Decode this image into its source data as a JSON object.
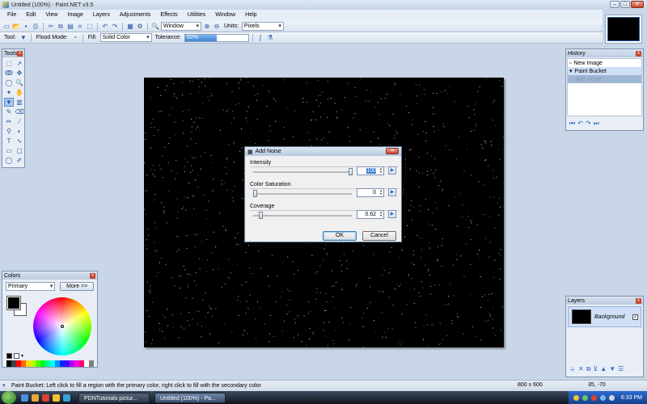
{
  "window": {
    "title": "Untitled (100%) - Paint.NET v3.5"
  },
  "menu": [
    "File",
    "Edit",
    "View",
    "Image",
    "Layers",
    "Adjustments",
    "Effects",
    "Utilities",
    "Window",
    "Help"
  ],
  "toolbar": {
    "window_combo": "Window",
    "units_label": "Units:",
    "units_value": "Pixels",
    "tool_label": "Tool:",
    "flood_mode_label": "Flood Mode:",
    "fill_label": "Fill:",
    "fill_value": "Solid Color",
    "tolerance_label": "Tolerance:",
    "tolerance_text": "50%",
    "tolerance_fraction": 0.5
  },
  "tools_panel": {
    "title": "Tools",
    "tools": [
      "rectangle-select",
      "move-selection",
      "lasso",
      "move-pixels",
      "ellipse-select",
      "zoom",
      "magic-wand",
      "pan",
      "paint-bucket",
      "gradient",
      "paintbrush",
      "eraser",
      "pencil",
      "color-picker",
      "clone-stamp",
      "recolor",
      "text",
      "line-curve",
      "rectangle",
      "rounded-rectangle",
      "ellipse",
      "freeform-shape"
    ]
  },
  "history_panel": {
    "title": "History",
    "items": [
      {
        "label": "New Image",
        "state": "normal"
      },
      {
        "label": "Paint Bucket",
        "state": "normal"
      },
      {
        "label": "Add Noise",
        "state": "dimmed"
      }
    ]
  },
  "colors_panel": {
    "title": "Colors",
    "select_value": "Primary",
    "more_label": "More >>",
    "primary": "#000000",
    "secondary": "#ffffff",
    "palette": [
      "#000000",
      "#404040",
      "#ff0000",
      "#ff6a00",
      "#ffd800",
      "#b6ff00",
      "#4cff00",
      "#00ff21",
      "#00ff90",
      "#00ffff",
      "#0094ff",
      "#0026ff",
      "#4800ff",
      "#b200ff",
      "#ff00dc",
      "#ff006e",
      "#ffffff",
      "#808080"
    ]
  },
  "layers_panel": {
    "title": "Layers",
    "layers": [
      {
        "name": "Background",
        "visible": true
      }
    ]
  },
  "dialog": {
    "title": "Add Noise",
    "intensity": {
      "label": "Intensity",
      "value": "100",
      "fraction": 1.0
    },
    "saturation": {
      "label": "Color Saturation",
      "value": "0",
      "fraction": 0.0
    },
    "coverage": {
      "label": "Coverage",
      "value": "0.62",
      "fraction": 0.06
    },
    "ok_label": "OK",
    "cancel_label": "Cancel"
  },
  "statusbar": {
    "message": "Paint Bucket: Left click to fill a region with the primary color, right click to fill with the secondary color",
    "image_size": "800 x 600",
    "cursor": "35, -70"
  },
  "taskbar": {
    "tasks": [
      {
        "label": "PDNTutorials pictur...",
        "active": false
      },
      {
        "label": "Untitled (100%) - Pa...",
        "active": true
      }
    ],
    "clock": "6:33 PM"
  }
}
